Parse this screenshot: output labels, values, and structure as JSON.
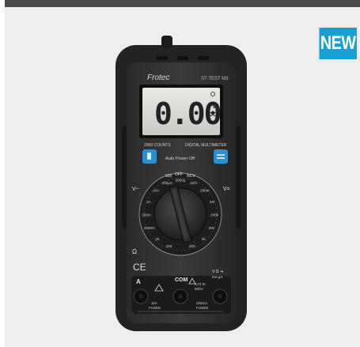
{
  "badge": {
    "label": "NEW",
    "color": "#1a9fd2"
  },
  "product": {
    "brand": "Frotec",
    "model": "ST-TEST M3",
    "display": {
      "reading": "0.00",
      "unit_top": "V",
      "unit_bottom": "DC"
    },
    "counts_label": "2000 COUNTS",
    "type_label": "DIGITAL MULTIMETER",
    "auto_off_label": "Auto Power Off",
    "left_button_icon": "flashlight-icon",
    "right_button_icon": "hold-icon",
    "dial": {
      "top_labels": [
        "600",
        "OFF",
        "NCV"
      ],
      "left_symbol": "V~",
      "right_symbol": "V=",
      "bottom_symbol": "Ω",
      "rim_labels": [
        "200",
        "20",
        "2000m",
        "200m",
        "2A",
        "10A",
        "200μA",
        "2000μ",
        "20m",
        "200m",
        "2M",
        "200k",
        "20k",
        "2k",
        "200"
      ]
    },
    "ce_mark": "CE",
    "terminals": {
      "a_label": "A",
      "a_rating": "10A",
      "a_fused": "FUSED",
      "com_label": "COM",
      "cat_label": "CAT III",
      "cat_voltage": "600V",
      "vohm_label": "V Ω ⇥",
      "vohm_sub": "mA μA",
      "vohm_rating": "200mA",
      "vohm_fused": "FUSED"
    }
  }
}
